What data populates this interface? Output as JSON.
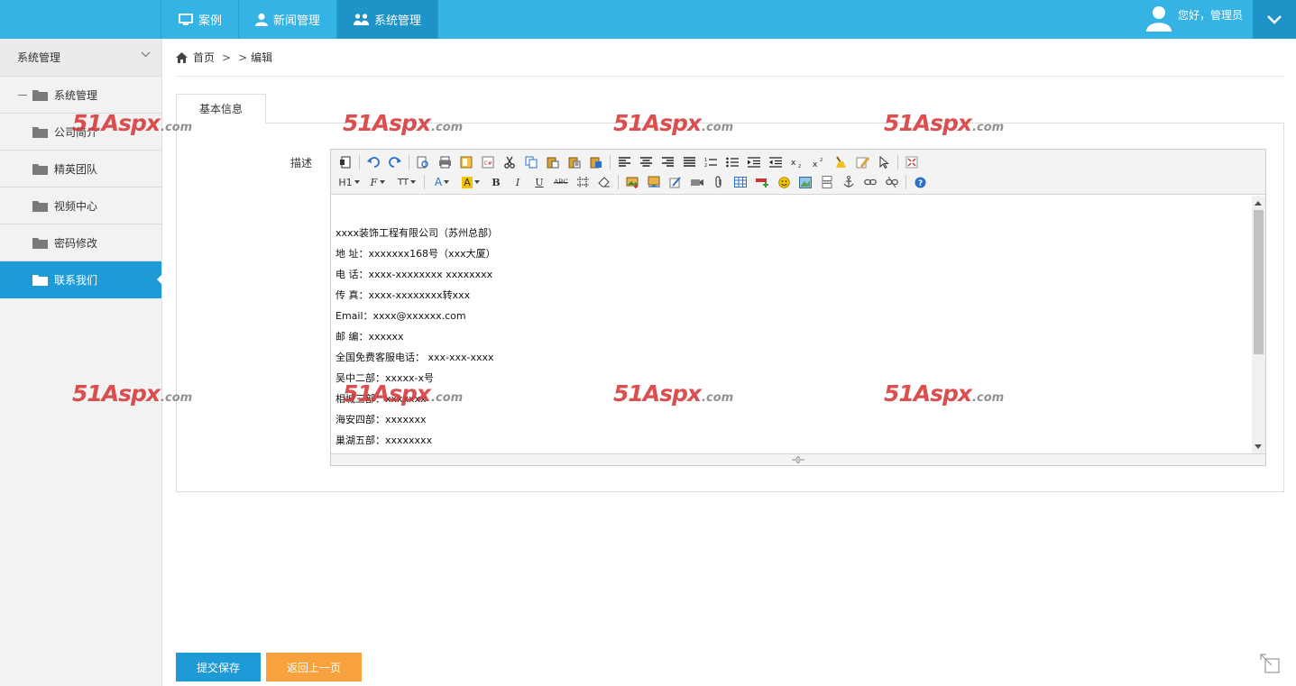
{
  "header": {
    "nav": [
      {
        "label": "案例",
        "icon": "monitor-icon"
      },
      {
        "label": "新闻管理",
        "icon": "user-icon"
      },
      {
        "label": "系统管理",
        "icon": "group-icon",
        "active": true
      }
    ],
    "greeting": "您好，管理员"
  },
  "sidebar": {
    "title": "系统管理",
    "group": "系统管理",
    "items": [
      {
        "label": "公司简介"
      },
      {
        "label": "精英团队"
      },
      {
        "label": "视频中心"
      },
      {
        "label": "密码修改"
      },
      {
        "label": "联系我们",
        "active": true
      }
    ]
  },
  "breadcrumb": {
    "home": "首页",
    "current": "编辑"
  },
  "form": {
    "tab": "基本信息",
    "field_label": "描述",
    "toolbar_labels": {
      "heading": "H1",
      "font": "F",
      "size": "TT",
      "color": "A",
      "bg": "A",
      "bold": "B",
      "italic": "I",
      "underline": "U",
      "strike": "ABC"
    },
    "content_lines": [
      "xxxx装饰工程有限公司（苏州总部）",
      "地 址：xxxxxxx168号（xxx大厦）",
      "电 话：xxxx-xxxxxxxx xxxxxxxx",
      "传 真：xxxx-xxxxxxxx转xxx",
      "Email：xxxx@xxxxxx.com",
      "邮 编：xxxxxx",
      "全国免费客服电话： xxx-xxx-xxxx",
      "吴中二部：xxxxx-x号",
      "相城三部：xxxxxxx",
      "海安四部：xxxxxxx",
      "巢湖五部：xxxxxxxx"
    ]
  },
  "buttons": {
    "save": "提交保存",
    "back": "返回上一页"
  },
  "watermark": {
    "brand": "51Aspx",
    "suffix": ".com"
  },
  "colors": {
    "topbar": "#35b3e4",
    "active": "#1e9ad6",
    "orange": "#f7a23c"
  }
}
